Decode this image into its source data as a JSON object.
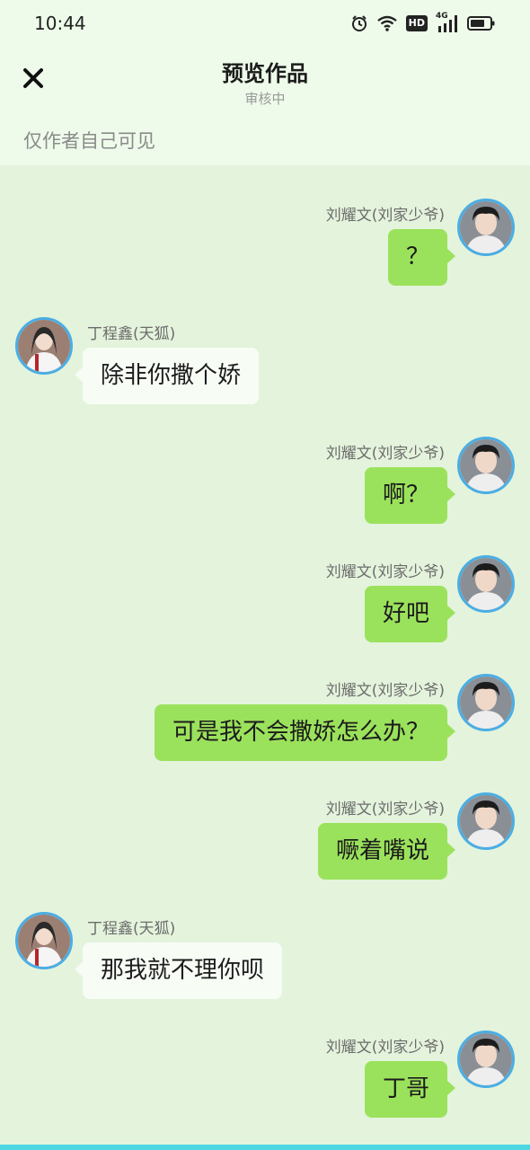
{
  "status_bar": {
    "time": "10:44",
    "icons": [
      "alarm-icon",
      "wifi-icon",
      "hd-icon",
      "4g-signal-icon",
      "battery-icon"
    ],
    "network_label": "4G",
    "hd_label": "HD"
  },
  "header": {
    "title": "预览作品",
    "subtitle": "审核中",
    "visibility_note": "仅作者自己可见",
    "close_icon": "close-icon"
  },
  "messages": [
    {
      "side": "right",
      "name": "刘耀文(刘家少爷)",
      "text": "？"
    },
    {
      "side": "left",
      "name": "丁程鑫(天狐)",
      "text": "除非你撒个娇"
    },
    {
      "side": "right",
      "name": "刘耀文(刘家少爷)",
      "text": "啊？"
    },
    {
      "side": "right",
      "name": "刘耀文(刘家少爷)",
      "text": "好吧"
    },
    {
      "side": "right",
      "name": "刘耀文(刘家少爷)",
      "text": "可是我不会撒娇怎么办？"
    },
    {
      "side": "right",
      "name": "刘耀文(刘家少爷)",
      "text": "噘着嘴说"
    },
    {
      "side": "left",
      "name": "丁程鑫(天狐)",
      "text": "那我就不理你呗"
    },
    {
      "side": "right",
      "name": "刘耀文(刘家少爷)",
      "text": "丁哥"
    }
  ],
  "colors": {
    "chat_background": "#e4f3dc",
    "header_background": "#eefbea",
    "my_bubble": "#9be25c",
    "other_bubble": "#f7fcf5",
    "avatar_ring": "#4aaee4"
  }
}
